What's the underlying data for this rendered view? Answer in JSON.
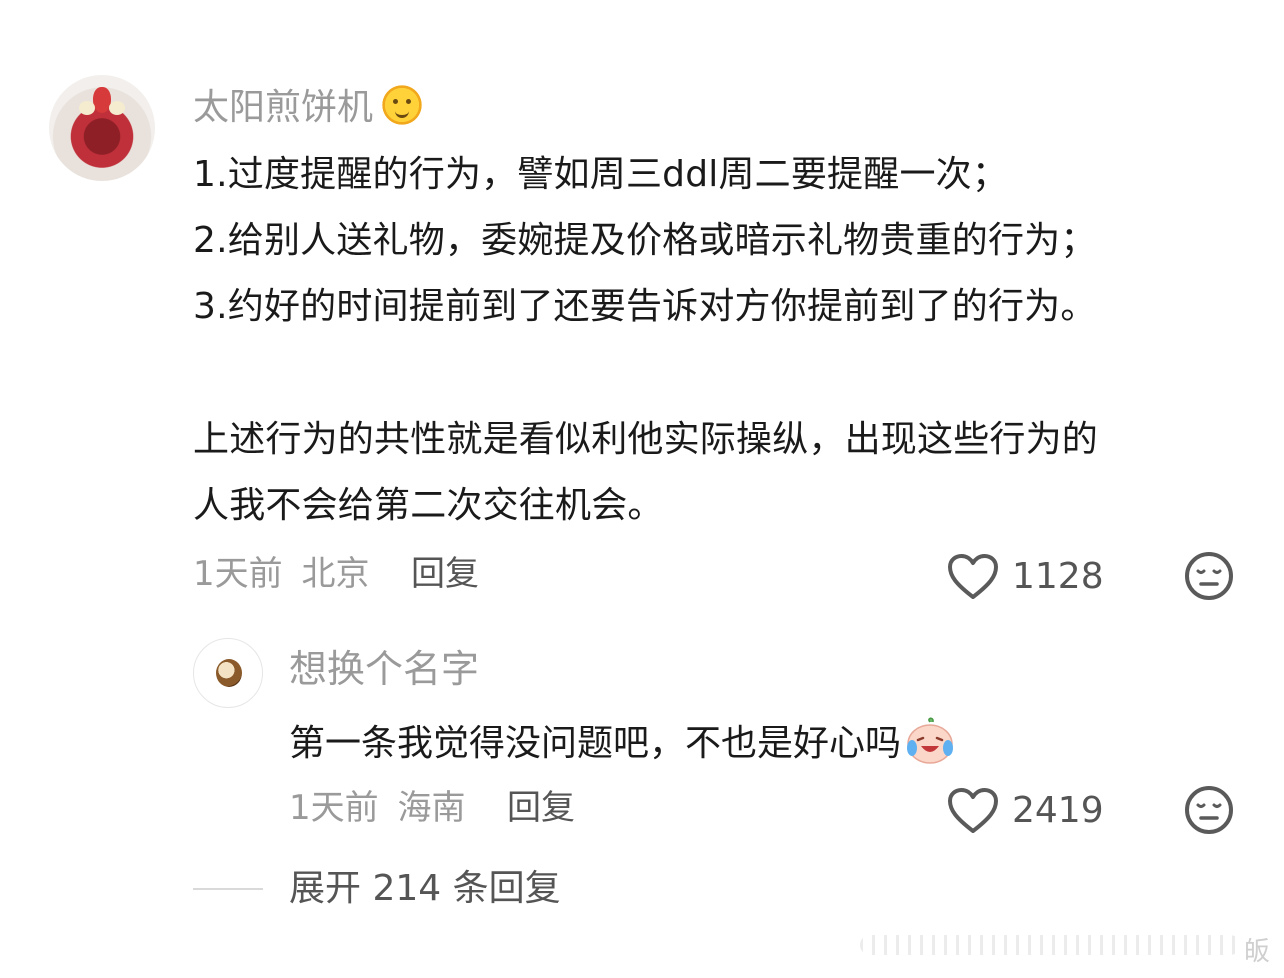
{
  "comment": {
    "username": "太阳煎饼机",
    "username_emoji": "sun-with-face-icon",
    "lines": [
      "1.过度提醒的行为，譬如周三ddl周二要提醒一次；",
      "2.给别人送礼物，委婉提及价格或暗示礼物贵重的行为；",
      "3.约好的时间提前到了还要告诉对方你提前到了的行为。",
      "上述行为的共性就是看似利他实际操纵，出现这些行为的",
      "人我不会给第二次交往机会。"
    ],
    "time": "1天前",
    "location": "北京",
    "reply_label": "回复",
    "likes": "1128"
  },
  "reply": {
    "username": "想换个名字",
    "text": "第一条我觉得没问题吧，不也是好心吗",
    "text_emoji": "crying-laughing-face-icon",
    "time": "1天前",
    "location": "海南",
    "reply_label": "回复",
    "likes": "2419"
  },
  "expand_label": "展开 214 条回复",
  "watermark_char": "皈",
  "colors": {
    "text": "#1a1a1a",
    "muted": "#9a9a9a",
    "secondary": "#555555"
  }
}
